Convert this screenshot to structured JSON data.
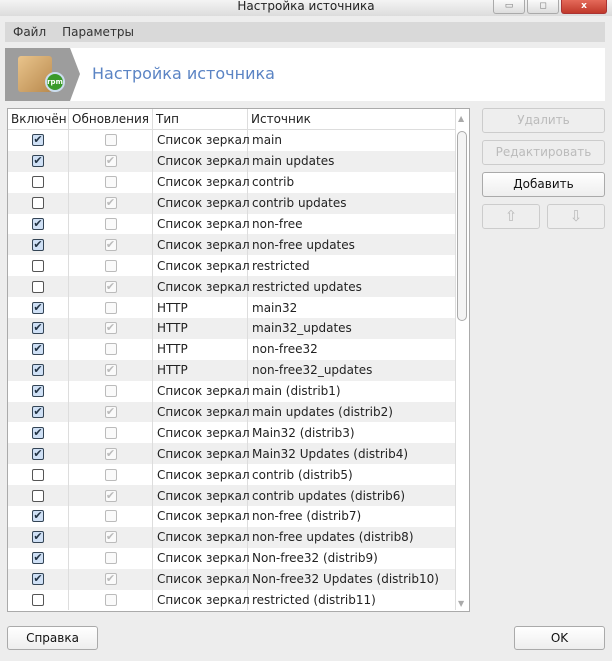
{
  "window": {
    "title": "Настройка источника",
    "minimize": "▭",
    "maximize": "◻",
    "close": "x"
  },
  "menu": {
    "file": "Файл",
    "params": "Параметры"
  },
  "banner": {
    "title": "Настройка источника",
    "logo_badge": "rpm"
  },
  "table": {
    "headers": [
      "Включён",
      "Обновления",
      "Тип",
      "Источник"
    ],
    "rows": [
      {
        "enabled": true,
        "updates": false,
        "type": "Список зеркал",
        "source": "main"
      },
      {
        "enabled": true,
        "updates": true,
        "type": "Список зеркал",
        "source": "main updates"
      },
      {
        "enabled": false,
        "updates": false,
        "type": "Список зеркал",
        "source": "contrib"
      },
      {
        "enabled": false,
        "updates": true,
        "type": "Список зеркал",
        "source": "contrib updates"
      },
      {
        "enabled": true,
        "updates": false,
        "type": "Список зеркал",
        "source": "non-free"
      },
      {
        "enabled": true,
        "updates": true,
        "type": "Список зеркал",
        "source": "non-free updates"
      },
      {
        "enabled": false,
        "updates": false,
        "type": "Список зеркал",
        "source": "restricted"
      },
      {
        "enabled": false,
        "updates": true,
        "type": "Список зеркал",
        "source": "restricted updates"
      },
      {
        "enabled": true,
        "updates": false,
        "type": "HTTP",
        "source": "main32"
      },
      {
        "enabled": true,
        "updates": true,
        "type": "HTTP",
        "source": "main32_updates"
      },
      {
        "enabled": true,
        "updates": false,
        "type": "HTTP",
        "source": "non-free32"
      },
      {
        "enabled": true,
        "updates": true,
        "type": "HTTP",
        "source": "non-free32_updates"
      },
      {
        "enabled": true,
        "updates": false,
        "type": "Список зеркал",
        "source": "main (distrib1)"
      },
      {
        "enabled": true,
        "updates": true,
        "type": "Список зеркал",
        "source": "main updates (distrib2)"
      },
      {
        "enabled": true,
        "updates": false,
        "type": "Список зеркал",
        "source": "Main32 (distrib3)"
      },
      {
        "enabled": true,
        "updates": true,
        "type": "Список зеркал",
        "source": "Main32 Updates (distrib4)"
      },
      {
        "enabled": false,
        "updates": false,
        "type": "Список зеркал",
        "source": "contrib (distrib5)"
      },
      {
        "enabled": false,
        "updates": true,
        "type": "Список зеркал",
        "source": "contrib updates (distrib6)"
      },
      {
        "enabled": true,
        "updates": false,
        "type": "Список зеркал",
        "source": "non-free (distrib7)"
      },
      {
        "enabled": true,
        "updates": true,
        "type": "Список зеркал",
        "source": "non-free updates (distrib8)"
      },
      {
        "enabled": true,
        "updates": false,
        "type": "Список зеркал",
        "source": "Non-free32 (distrib9)"
      },
      {
        "enabled": true,
        "updates": true,
        "type": "Список зеркал",
        "source": "Non-free32 Updates (distrib10)"
      },
      {
        "enabled": false,
        "updates": false,
        "type": "Список зеркал",
        "source": "restricted (distrib11)"
      }
    ]
  },
  "buttons": {
    "delete": "Удалить",
    "edit": "Редактировать",
    "add": "Добавить",
    "up": "⇧",
    "down": "⇩",
    "help": "Справка",
    "ok": "OK"
  }
}
